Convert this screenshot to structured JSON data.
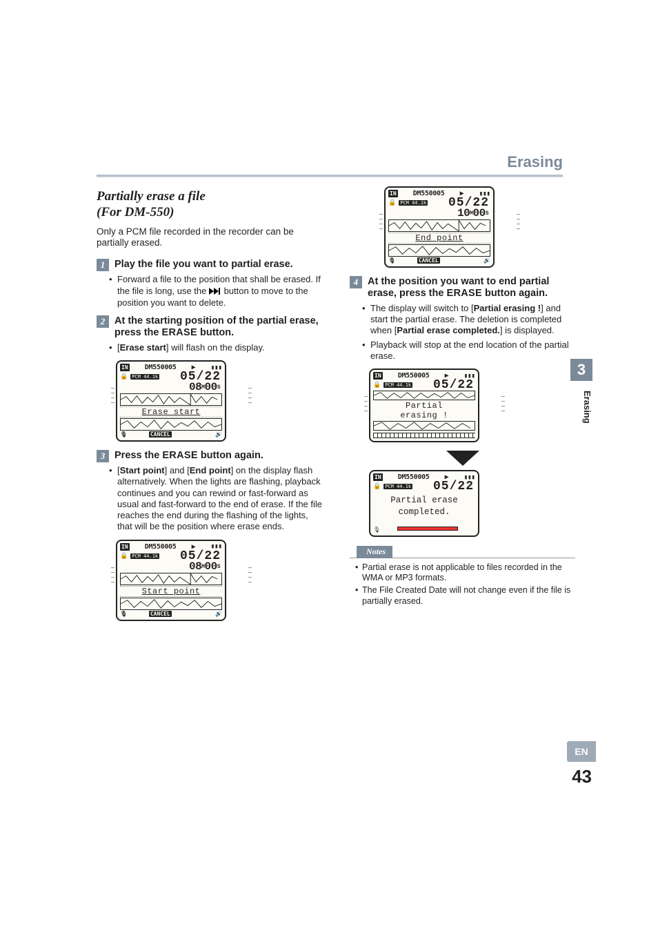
{
  "chapter_tab": "3",
  "section_vertical": "Erasing",
  "header": {
    "title": "Erasing"
  },
  "subtitle_line1": "Partially erase a file",
  "subtitle_line2": "(For DM-550)",
  "intro": "Only a PCM file recorded in the recorder can be partially erased.",
  "steps": {
    "s1": {
      "num": "1",
      "title": "Play the file you want to partial erase.",
      "bullets": [
        {
          "pre": "Forward a file to the position that shall be erased. If the file is long, use the ",
          "icon": "ff",
          "post": " button to move to the position you want to delete."
        }
      ]
    },
    "s2": {
      "num": "2",
      "title_pre": "At the starting position of the partial erase, press the ",
      "title_btn": "ERASE",
      "title_post": " button.",
      "bullets": [
        {
          "pre": "[",
          "bold": "Erase start",
          "post": "] will flash on the display."
        }
      ]
    },
    "s3": {
      "num": "3",
      "title_pre": "Press the ",
      "title_btn": "ERASE",
      "title_post": " button again.",
      "bullets": [
        {
          "pre": "[",
          "bold": "Start point",
          "post": "] and [",
          "bold2": "End point",
          "post2": "] on the display flash alternatively. When the lights are flashing, playback continues and you can rewind or fast-forward as usual and fast-forward to the end of erase. If the file reaches the end during the flashing of the lights, that will be the position where erase ends."
        }
      ]
    },
    "s4": {
      "num": "4",
      "title_pre": "At the position you want to end partial erase, press the ",
      "title_btn": "ERASE",
      "title_post": " button again.",
      "bullets": [
        {
          "pre": "The display will switch to [",
          "bold": "Partial erasing !",
          "post": "] and start the partial erase. The deletion is completed when [",
          "bold2": "Partial erase completed.",
          "post2": "] is displayed."
        },
        {
          "text": "Playback will stop at the end location of the partial erase."
        }
      ]
    }
  },
  "lcd": {
    "in": "IN",
    "file": "DM550005",
    "play": "▶",
    "batt": "▮▮▮",
    "pcm": "PCM 44.1k",
    "counter": "05/22",
    "time_08": {
      "mm": "08",
      "mlab": "M",
      "ss": "00",
      "slab": "S"
    },
    "time_10": {
      "mm": "10",
      "mlab": "M",
      "ss": "00",
      "slab": "S"
    },
    "status_erase_start": "Erase start",
    "status_start_point": "Start point",
    "status_end_point": "End point",
    "status_partial_erasing_l1": "Partial",
    "status_partial_erasing_l2": "erasing !",
    "status_completed_l1": "Partial erase",
    "status_completed_l2": "completed.",
    "cancel": "CANCEL"
  },
  "notes": {
    "label": "Notes",
    "items": [
      "Partial erase is not applicable to files recorded in the WMA or MP3 formats.",
      "The File Created Date will not change even if the file is partially erased."
    ]
  },
  "lang_tab": "EN",
  "page_number": "43"
}
